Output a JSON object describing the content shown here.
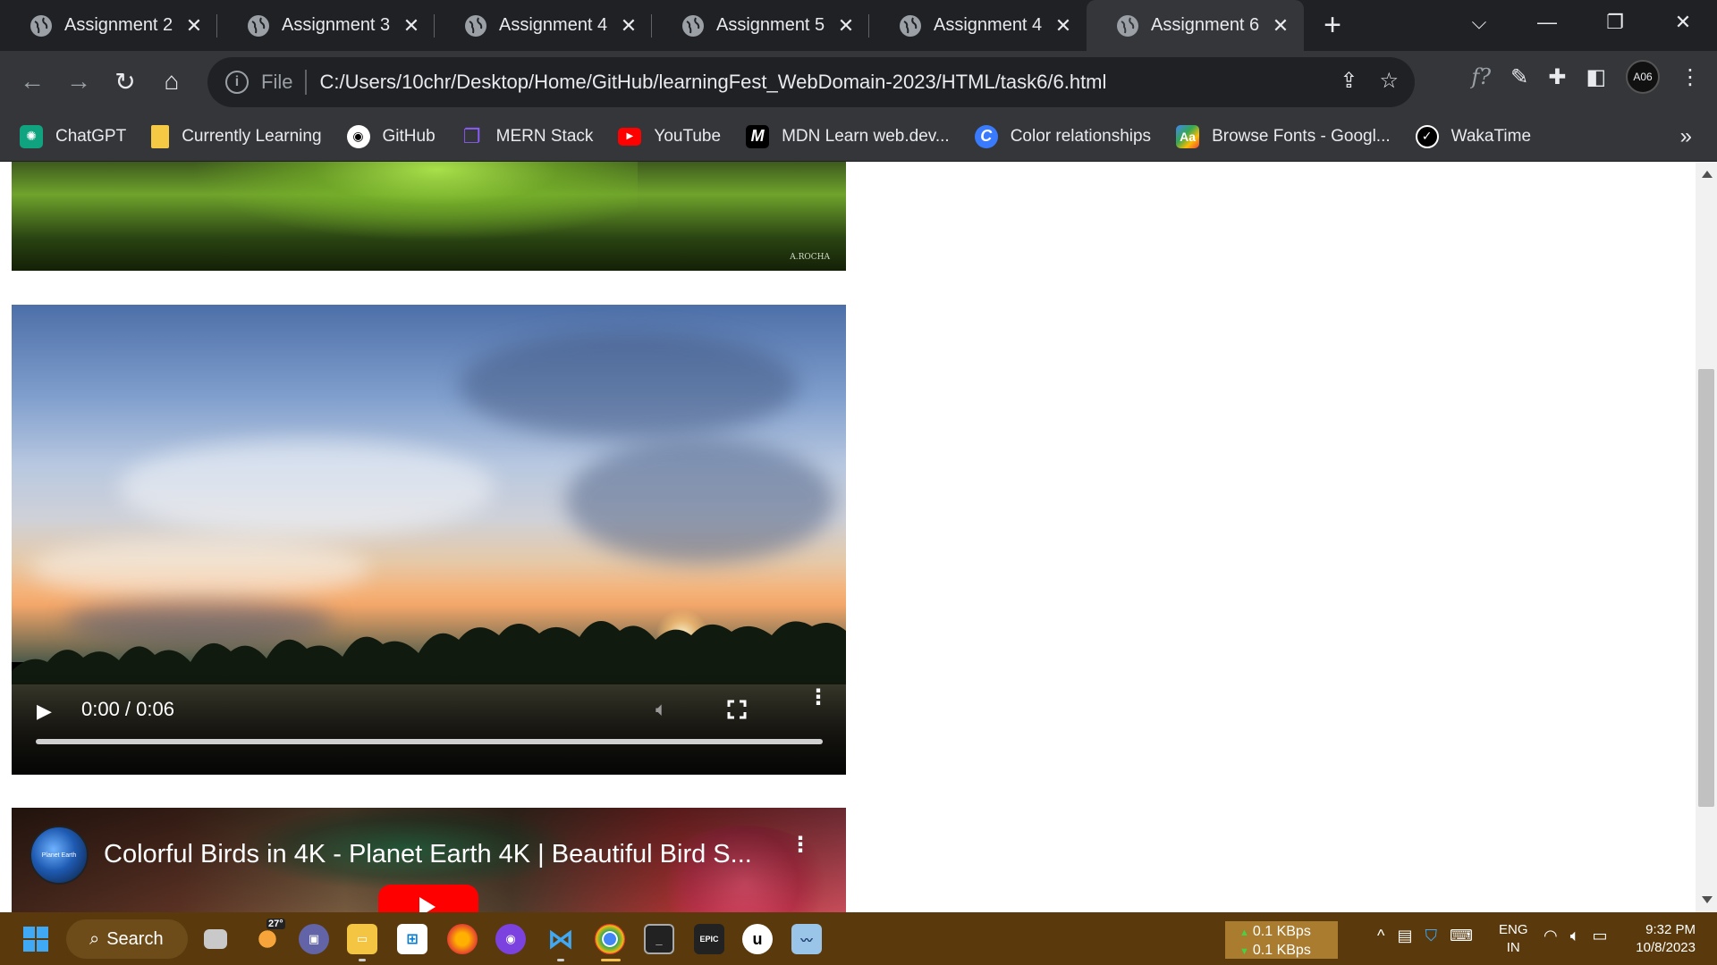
{
  "browser": {
    "tabs": [
      {
        "label": "Assignment 2",
        "active": false
      },
      {
        "label": "Assignment 3",
        "active": false
      },
      {
        "label": "Assignment 4",
        "active": false
      },
      {
        "label": "Assignment 5",
        "active": false
      },
      {
        "label": "Assignment 4",
        "active": false
      },
      {
        "label": "Assignment 6",
        "active": true
      }
    ],
    "omnibox": {
      "scheme_label": "File",
      "url": "C:/Users/10chr/Desktop/Home/GitHub/learningFest_WebDomain-2023/HTML/task6/6.html"
    },
    "profile": {
      "initials": "A06"
    },
    "bookmarks": [
      {
        "label": "ChatGPT",
        "icon": "chatgpt-icon",
        "color": "#10a37f"
      },
      {
        "label": "Currently Learning",
        "icon": "folder-icon",
        "color": "#f6c945"
      },
      {
        "label": "GitHub",
        "icon": "github-icon",
        "color": "#ffffff"
      },
      {
        "label": "MERN Stack",
        "icon": "book-icon",
        "color": "#8b5cf6"
      },
      {
        "label": "YouTube",
        "icon": "youtube-icon",
        "color": "#ff0000"
      },
      {
        "label": "MDN Learn web.dev...",
        "icon": "mdn-icon",
        "color": "#000000"
      },
      {
        "label": "Color relationships",
        "icon": "canva-icon",
        "color": "#3a7bfd"
      },
      {
        "label": "Browse Fonts - Googl...",
        "icon": "google-fonts-icon",
        "color": "#4285f4"
      },
      {
        "label": "WakaTime",
        "icon": "wakatime-icon",
        "color": "#000000"
      }
    ],
    "bookmarks_more": "»"
  },
  "page": {
    "top_image": {
      "signature": "A.ROCHA"
    },
    "video": {
      "time": "0:00 / 0:06",
      "progress": 0
    },
    "youtube_embed": {
      "channel_badge": "Planet Earth",
      "title": "Colorful Birds in 4K - Planet Earth 4K | Beautiful Bird S..."
    }
  },
  "taskbar": {
    "search_label": "Search",
    "weather_temp": "27°",
    "net_up": "0.1 KBps",
    "net_down": "0.1 KBps",
    "lang_top": "ENG",
    "lang_bottom": "IN",
    "time": "9:32 PM",
    "date": "10/8/2023",
    "accent": "#5a3a0c"
  }
}
